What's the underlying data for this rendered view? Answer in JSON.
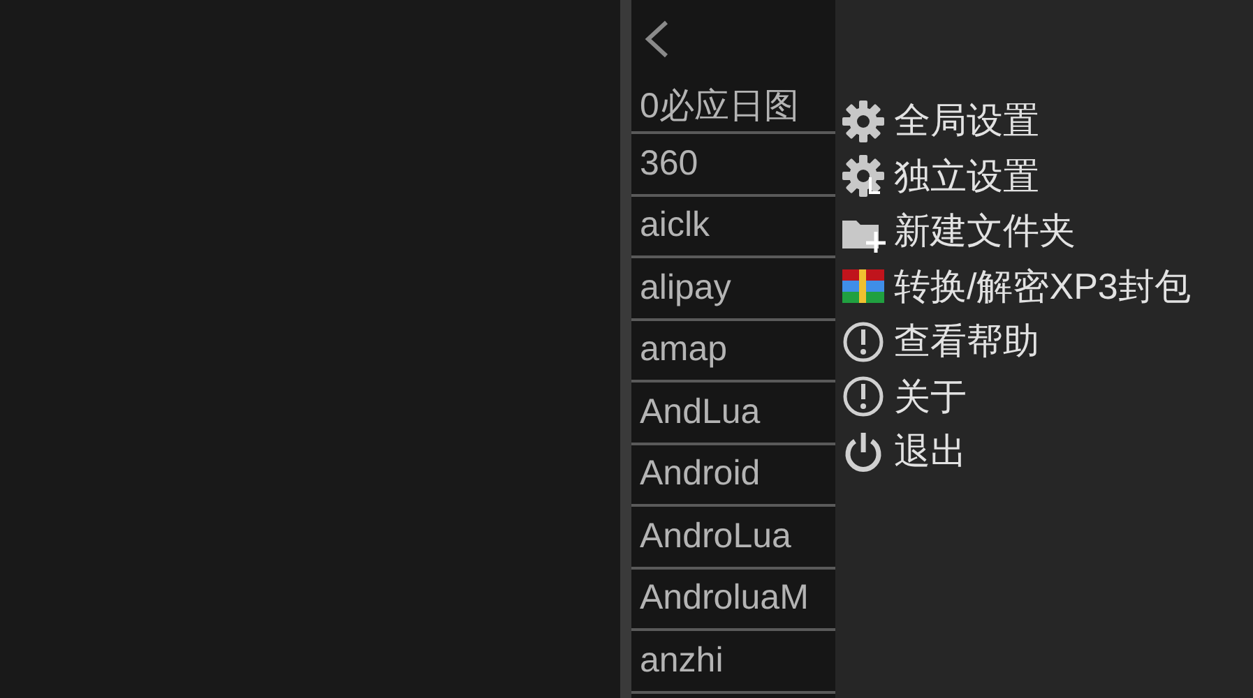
{
  "list": {
    "items": [
      {
        "label": "0必应日图"
      },
      {
        "label": "360"
      },
      {
        "label": "aiclk"
      },
      {
        "label": "alipay"
      },
      {
        "label": "amap"
      },
      {
        "label": "AndLua"
      },
      {
        "label": "Android"
      },
      {
        "label": "AndroLua"
      },
      {
        "label": "AndroluaM"
      },
      {
        "label": "anzhi"
      }
    ]
  },
  "menu": {
    "items": [
      {
        "label": "全局设置",
        "kind": "gear"
      },
      {
        "label": "独立设置",
        "kind": "gearmark"
      },
      {
        "label": "新建文件夹",
        "kind": "folder"
      },
      {
        "label": "转换/解密XP3封包",
        "kind": "blocks"
      },
      {
        "label": "查看帮助",
        "kind": "alert"
      },
      {
        "label": "关于",
        "kind": "alert"
      },
      {
        "label": "退出",
        "kind": "power"
      }
    ]
  }
}
